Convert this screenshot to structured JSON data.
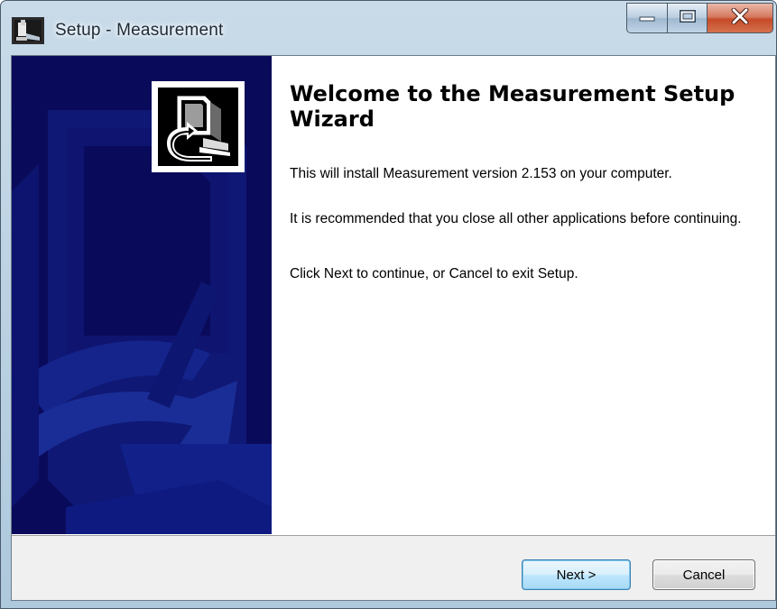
{
  "window": {
    "title": "Setup - Measurement",
    "caption_buttons": {
      "minimize_icon": "minimize-icon",
      "maximize_icon": "maximize-icon",
      "close_icon": "close-icon"
    }
  },
  "banner": {
    "logo_icon": "computer-install-icon",
    "background_color": "#0a0a5a"
  },
  "welcome": {
    "heading": "Welcome to the Measurement Setup Wizard",
    "paragraphs": [
      "This will install Measurement version 2.153 on your computer.",
      "It is recommended that you close all other applications before continuing.",
      "Click Next to continue, or Cancel to exit Setup."
    ]
  },
  "footer": {
    "next_label": "Next >",
    "cancel_label": "Cancel"
  },
  "colors": {
    "banner": "#0a0a5a",
    "next_button_border": "#3c7fb1",
    "close_button": "#c54a28"
  }
}
